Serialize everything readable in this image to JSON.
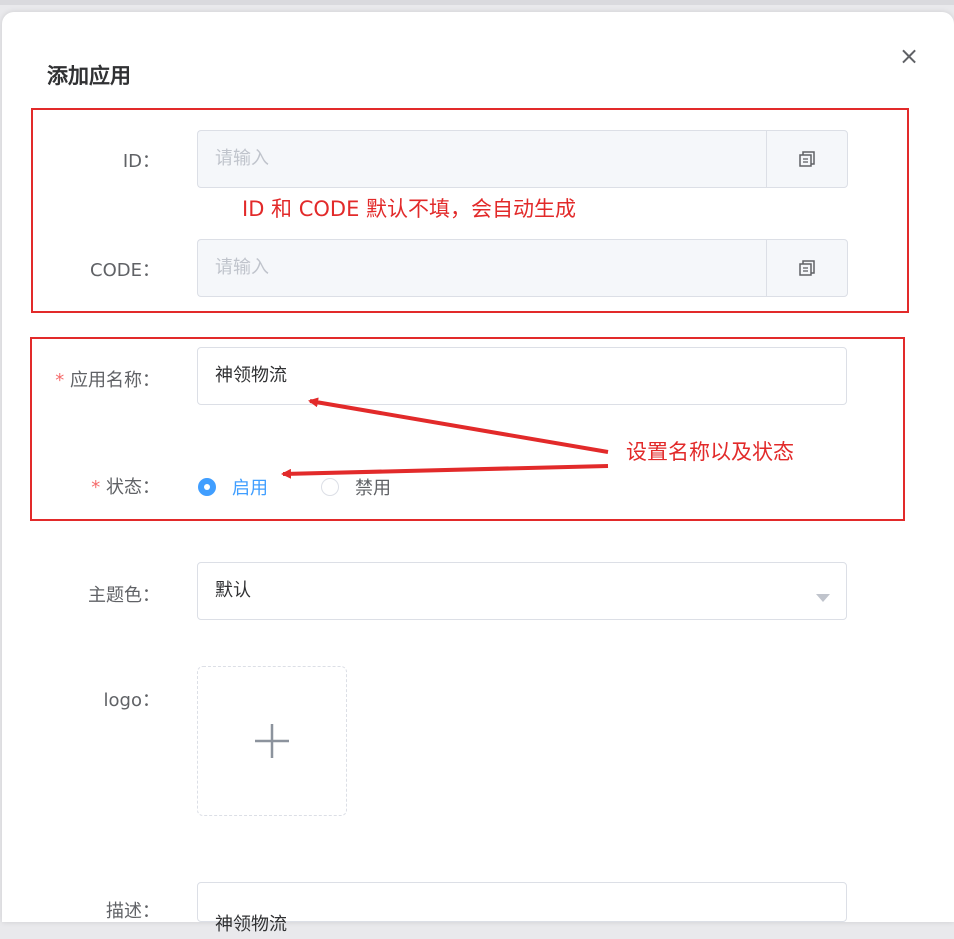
{
  "dialog": {
    "title": "添加应用",
    "close_label": "×"
  },
  "form": {
    "id": {
      "label": "ID：",
      "placeholder": "请输入"
    },
    "code": {
      "label": "CODE：",
      "placeholder": "请输入"
    },
    "app_name": {
      "required_mark": "*",
      "label": "应用名称：",
      "value": "神领物流"
    },
    "status": {
      "required_mark": "*",
      "label": "状态：",
      "options": [
        {
          "label": "启用",
          "selected": true
        },
        {
          "label": "禁用",
          "selected": false
        }
      ]
    },
    "theme_color": {
      "label": "主题色：",
      "value": "默认"
    },
    "logo": {
      "label": "logo：",
      "plus": "+"
    },
    "description": {
      "label": "描述：",
      "value": "神领物流"
    }
  },
  "annotations": {
    "id_code_note": "ID 和 CODE 默认不填，会自动生成",
    "name_status_note": "设置名称以及状态",
    "color": "#e22a2a"
  },
  "icons": {
    "copy": "copy-icon",
    "close": "close-icon",
    "dropdown": "chevron-down-icon",
    "plus": "plus-icon"
  },
  "colors": {
    "primary": "#409eff",
    "required": "#f56c6c",
    "annotation": "#e22a2a"
  }
}
